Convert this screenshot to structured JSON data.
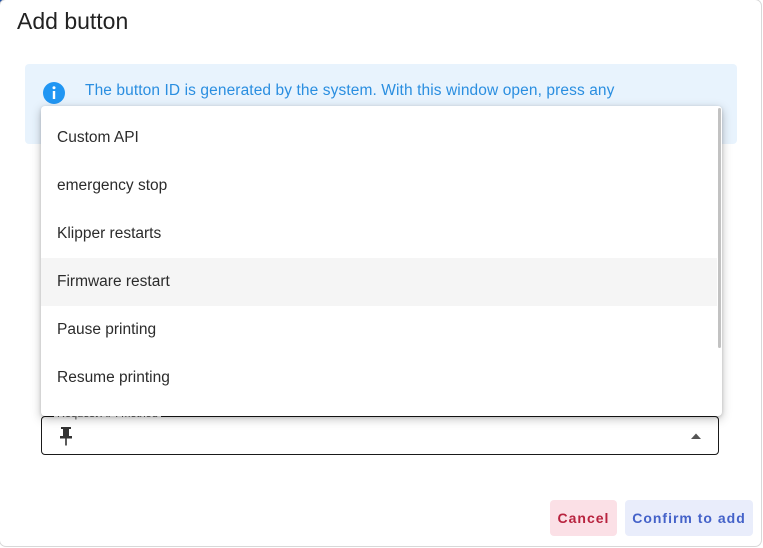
{
  "dialog": {
    "title": "Add button",
    "info_text": "The button ID is generated by the system. With this window open, press any",
    "info_icon": "info-circle-icon",
    "accent_color": "#2196f3"
  },
  "field": {
    "label": "Request API method",
    "icon": "pin-icon",
    "value": ""
  },
  "menu": {
    "items": [
      {
        "label": "Custom API"
      },
      {
        "label": "emergency stop"
      },
      {
        "label": "Klipper restarts"
      },
      {
        "label": "Firmware restart"
      },
      {
        "label": "Pause printing"
      },
      {
        "label": "Resume printing"
      }
    ]
  },
  "actions": {
    "cancel_label": "Cancel",
    "confirm_label": "Confirm to add",
    "cancel_color": "#b8233f",
    "confirm_color": "#4462c9"
  }
}
